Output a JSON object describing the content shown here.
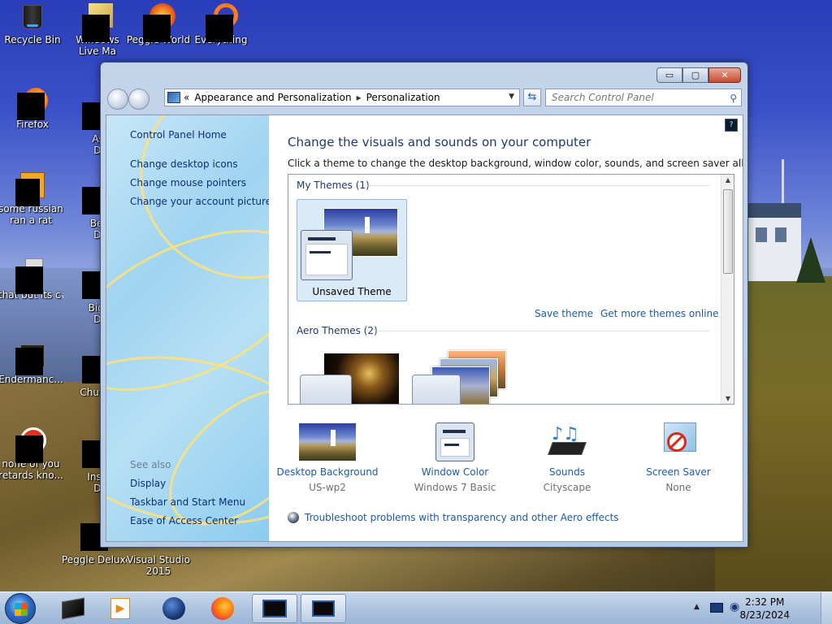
{
  "desktop": {
    "icons": [
      {
        "label": "Recycle Bin",
        "icon": "recycle-bin-icon"
      },
      {
        "label": "Windows Live Ma",
        "icon": "windows-live-icon"
      },
      {
        "label": "Peggle World",
        "icon": "peggle-world-icon"
      },
      {
        "label": "Everything",
        "icon": "everything-icon"
      },
      {
        "label": "Firefox",
        "icon": "firefox-icon"
      },
      {
        "label": "Astro Delu",
        "icon": "game-icon"
      },
      {
        "label": "some russian ran a rat",
        "icon": "file-icon"
      },
      {
        "label": "Bejew Delu",
        "icon": "game-icon"
      },
      {
        "label": "that but its c#",
        "icon": "copy-icon"
      },
      {
        "label": "Big Mo Delu",
        "icon": "game-icon"
      },
      {
        "label": "Endermanc...",
        "icon": "app-icon"
      },
      {
        "label": "Chuz Delu",
        "icon": "game-icon"
      },
      {
        "label": "none of you retards kno...",
        "icon": "app-icon"
      },
      {
        "label": "Insaniq Delu",
        "icon": "game-icon"
      },
      {
        "label": "Peggle Deluxe",
        "icon": "peggle-icon"
      },
      {
        "label": "Visual Studio 2015",
        "icon": "visual-studio-icon"
      }
    ]
  },
  "window": {
    "breadcrumb": {
      "prefix": "«",
      "items": [
        "Appearance and Personalization",
        "Personalization"
      ],
      "separator": "▸"
    },
    "search_placeholder": "Search Control Panel",
    "controls": {
      "minimize": "▭",
      "maximize": "▢",
      "close": "✕"
    },
    "left_pane": {
      "home_link": "Control Panel Home",
      "links": [
        "Change desktop icons",
        "Change mouse pointers",
        "Change your account picture"
      ],
      "see_also_heading": "See also",
      "see_also": [
        "Display",
        "Taskbar and Start Menu",
        "Ease of Access Center"
      ]
    },
    "main": {
      "title": "Change the visuals and sounds on your computer",
      "subtitle": "Click a theme to change the desktop background, window color, sounds, and screen saver all at once.",
      "my_themes_heading": "My Themes (1)",
      "unsaved_theme_label": "Unsaved Theme",
      "save_theme_link": "Save theme",
      "get_more_link": "Get more themes online",
      "aero_themes_heading": "Aero Themes (2)",
      "settings": [
        {
          "name": "Desktop Background",
          "value": "US-wp2",
          "icon": "desktop-background-icon"
        },
        {
          "name": "Window Color",
          "value": "Windows 7 Basic",
          "icon": "window-color-icon"
        },
        {
          "name": "Sounds",
          "value": "Cityscape",
          "icon": "sounds-icon"
        },
        {
          "name": "Screen Saver",
          "value": "None",
          "icon": "screen-saver-icon"
        }
      ],
      "troubleshoot_link": "Troubleshoot problems with transparency and other Aero effects"
    }
  },
  "taskbar": {
    "time": "2:32 PM",
    "date": "8/23/2024",
    "items": [
      "explorer-icon",
      "media-player-icon",
      "globe-icon",
      "firefox-icon",
      "control-panel-window",
      "display-window"
    ]
  }
}
